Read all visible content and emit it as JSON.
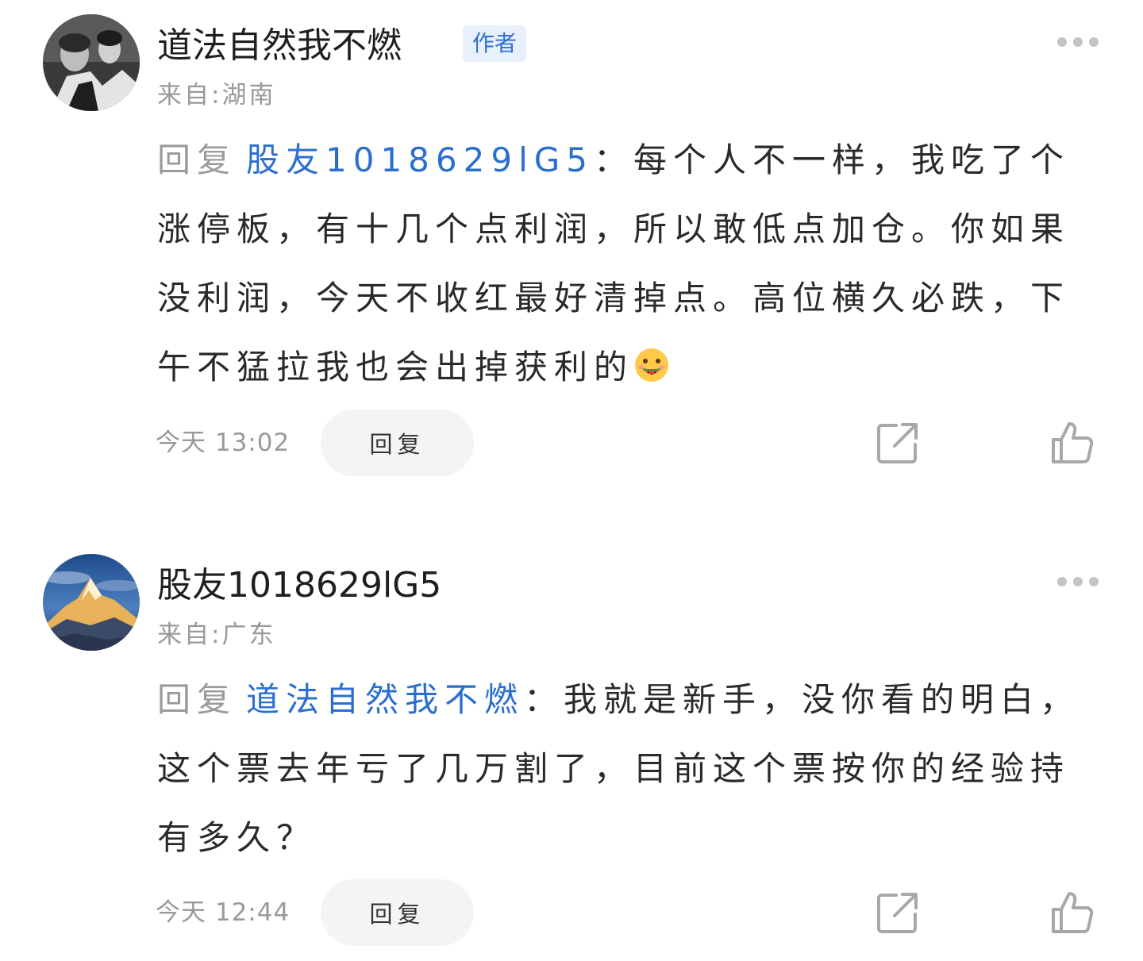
{
  "comments": [
    {
      "username": "道法自然我不燃",
      "badge": "作者",
      "location": "来自:湖南",
      "reply_prefix": "回复",
      "mention": "股友1018629lG5",
      "colon": "：",
      "text": "每个人不一样，我吃了个涨停板，有十几个点利润，所以敢低点加仓。你如果没利润，今天不收红最好清掉点。高位横久必跌，下午不猛拉我也会出掉获利的",
      "emoji": "watermelon-face-emoji",
      "time": "今天  13:02",
      "reply_button": "回复"
    },
    {
      "username": "股友1018629lG5",
      "location": "来自:广东",
      "reply_prefix": "回复",
      "mention": "道法自然我不燃",
      "colon": "：",
      "text": "我就是新手，没你看的明白，这个票去年亏了几万割了，目前这个票按你的经验持有多久？",
      "time": "今天  12:44",
      "reply_button": "回复"
    }
  ],
  "icons": {
    "more": "more-dots-icon",
    "share": "share-icon",
    "like": "thumbs-up-icon"
  },
  "colors": {
    "mention": "#2a6fd0",
    "badge_bg": "#e8f0fb",
    "badge_text": "#2f6fd6",
    "muted": "#9a9a9a",
    "reply_button_bg": "#f3f4f6"
  }
}
